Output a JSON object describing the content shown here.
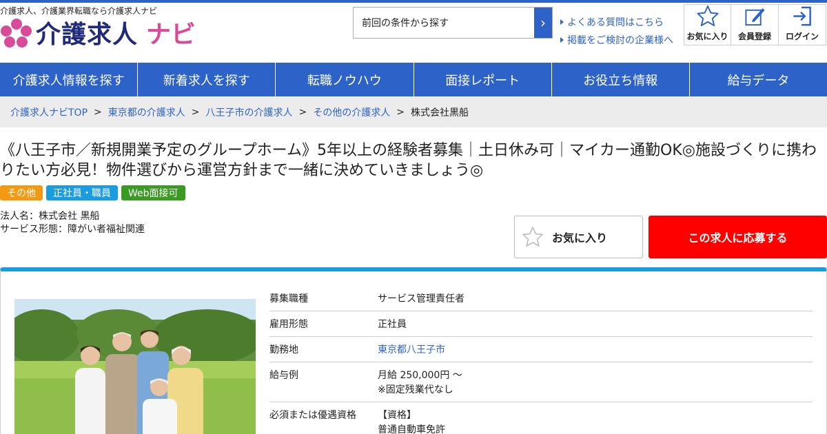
{
  "header": {
    "tagline": "介護求人、介護業界転職なら介護求人ナビ",
    "logo_main": "介護求人",
    "logo_sub": "ナビ",
    "search_label": "前回の条件から探す",
    "links": [
      "よくある質問はこちら",
      "掲載をご検討の企業様へ"
    ],
    "icon_buttons": [
      {
        "label": "お気に入り",
        "icon": "star-icon"
      },
      {
        "label": "会員登録",
        "icon": "edit-icon"
      },
      {
        "label": "ログイン",
        "icon": "login-icon"
      }
    ]
  },
  "nav": [
    "介護求人情報を探す",
    "新着求人を探す",
    "転職ノウハウ",
    "面接レポート",
    "お役立ち情報",
    "給与データ"
  ],
  "breadcrumb": {
    "items": [
      "介護求人ナビTOP",
      "東京都の介護求人",
      "八王子市の介護求人",
      "その他の介護求人"
    ],
    "separator": ">",
    "current": "株式会社黒船"
  },
  "job": {
    "title": "《八王子市／新規開業予定のグループホーム》5年以上の経験者募集｜土日休み可｜マイカー通勤OK◎施設づくりに携わりたい方必見！物件選びから運営方針まで一緒に決めていきましょう◎",
    "tags": [
      {
        "label": "その他",
        "color": "#f39a12"
      },
      {
        "label": "正社員・職員",
        "color": "#1b9be0"
      },
      {
        "label": "Web面接可",
        "color": "#3a9a24"
      }
    ],
    "corp_name": "法人名：株式会社 黒船",
    "service_type": "サービス形態：障がい者福祉関連",
    "fav_label": "お気に入り",
    "apply_label": "この求人に応募する"
  },
  "details": [
    {
      "key": "募集職種",
      "value": "サービス管理責任者"
    },
    {
      "key": "雇用形態",
      "value": "正社員"
    },
    {
      "key": "勤務地",
      "value": "東京都八王子市"
    },
    {
      "key": "給与例",
      "value": "月給 250,000円 〜",
      "value2": "※固定残業代なし"
    },
    {
      "key": "必須または優遇資格",
      "value": "【資格】",
      "value2": "普通自動車免許"
    }
  ],
  "colors": {
    "brand_blue": "#2d63c8",
    "accent_pink": "#d74b98",
    "apply_red": "#ff0000",
    "panel_border": "#1b9be0"
  }
}
